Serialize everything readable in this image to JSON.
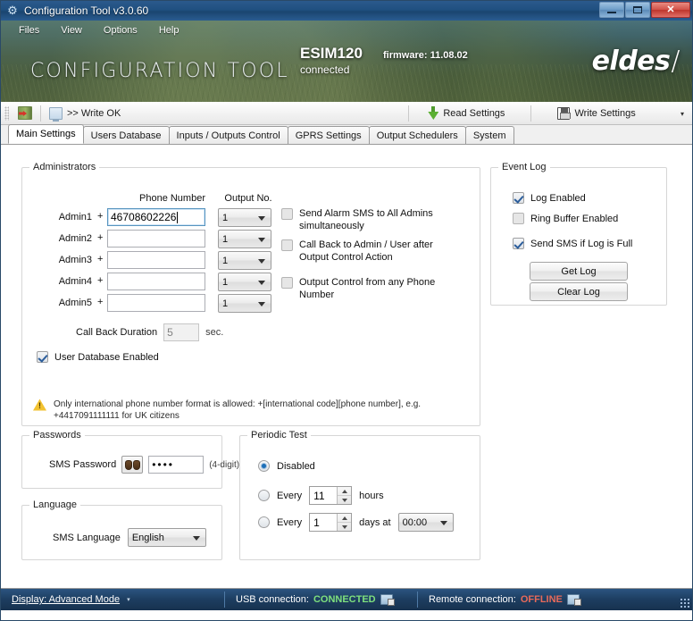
{
  "window": {
    "title": "Configuration Tool v3.0.60",
    "icon": "gear-icon",
    "minimize_label": "Minimize",
    "maximize_label": "Maximize",
    "close_label": "✕"
  },
  "menu": {
    "items": [
      {
        "label": "Files"
      },
      {
        "label": "View"
      },
      {
        "label": "Options"
      },
      {
        "label": "Help"
      }
    ]
  },
  "banner": {
    "title": "CONFIGURATION TOOL",
    "model": "ESIM120",
    "firmware": "firmware: 11.08.02",
    "connection_state": "connected",
    "logo": "eldes",
    "logo_mark": "/"
  },
  "toolbar": {
    "exit_icon": "exit-door-icon",
    "device_icon": "monitor-icon",
    "status_text": ">> Write OK",
    "read_settings_label": "Read Settings",
    "read_icon": "green-down-arrow-icon",
    "write_settings_label": "Write Settings",
    "write_icon": "floppy-disk-icon",
    "overflow_label": "▾"
  },
  "tabs": [
    {
      "label": "Main Settings",
      "active": true
    },
    {
      "label": "Users Database",
      "active": false
    },
    {
      "label": "Inputs / Outputs Control",
      "active": false
    },
    {
      "label": "GPRS Settings",
      "active": false
    },
    {
      "label": "Output Schedulers",
      "active": false
    },
    {
      "label": "System",
      "active": false
    }
  ],
  "administrators": {
    "title": "Administrators",
    "col_phone": "Phone Number",
    "col_output": "Output No.",
    "plus_sign": "+",
    "rows": [
      {
        "label": "Admin1",
        "phone": "46708602226",
        "output": "1",
        "focused": true
      },
      {
        "label": "Admin2",
        "phone": "",
        "output": "1",
        "focused": false
      },
      {
        "label": "Admin3",
        "phone": "",
        "output": "1",
        "focused": false
      },
      {
        "label": "Admin4",
        "phone": "",
        "output": "1",
        "focused": false
      },
      {
        "label": "Admin5",
        "phone": "",
        "output": "1",
        "focused": false
      }
    ],
    "options": [
      {
        "label": "Send Alarm SMS to All Admins simultaneously",
        "checked": false
      },
      {
        "label": "Call Back to Admin / User after Output Control Action",
        "checked": false
      },
      {
        "label": "Output Control from any Phone Number",
        "checked": false
      }
    ],
    "callback_duration_label": "Call Back Duration",
    "callback_duration_value": "5",
    "callback_duration_unit": "sec.",
    "user_db_label": "User Database Enabled",
    "user_db_checked": true,
    "warning_icon": "warning-triangle-icon",
    "warning_text": "Only international phone number format is allowed: +[international code][phone number], e.g. +4417091111111 for UK citizens"
  },
  "event_log": {
    "title": "Event Log",
    "options": [
      {
        "label": "Log Enabled",
        "checked": true
      },
      {
        "label": "Ring Buffer Enabled",
        "checked": false
      },
      {
        "label": "Send SMS if Log is Full",
        "checked": true
      }
    ],
    "get_log_label": "Get Log",
    "clear_log_label": "Clear Log"
  },
  "passwords": {
    "title": "Passwords",
    "sms_password_label": "SMS Password",
    "reveal_icon": "binoculars-icon",
    "sms_password_value": "••••",
    "hint": "(4-digit)"
  },
  "language": {
    "title": "Language",
    "sms_language_label": "SMS Language",
    "sms_language_value": "English"
  },
  "periodic_test": {
    "title": "Periodic Test",
    "disabled_label": "Disabled",
    "disabled_selected": true,
    "hours_every_label": "Every",
    "hours_value": "11",
    "hours_unit": "hours",
    "hours_selected": false,
    "days_every_label": "Every",
    "days_value": "1",
    "days_unit": "days at",
    "days_time": "00:00",
    "days_selected": false
  },
  "statusbar": {
    "display_mode": "Display: Advanced Mode",
    "display_caret": "▾",
    "usb_label": "USB connection:",
    "usb_state": "CONNECTED",
    "usb_icon": "usb-connection-icon",
    "remote_label": "Remote connection:",
    "remote_state": "OFFLINE",
    "remote_icon": "remote-connection-icon"
  },
  "colors": {
    "accent_blue": "#1d3d60",
    "connected_green": "#7ee07e",
    "offline_red": "#e86a5a",
    "warning_yellow": "#f2c230"
  }
}
